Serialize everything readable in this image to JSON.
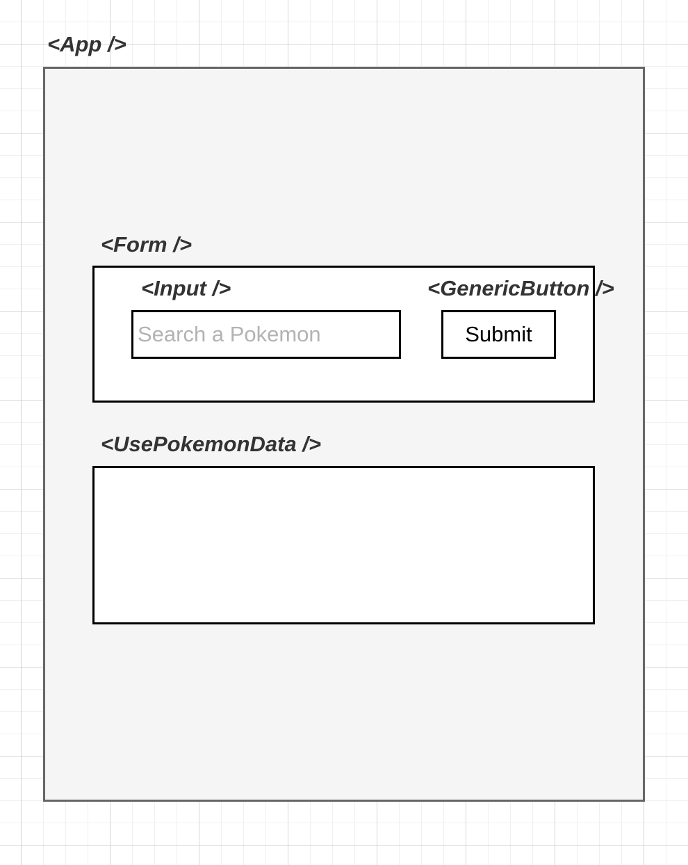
{
  "app": {
    "label": "<App />"
  },
  "form": {
    "label": "<Form />"
  },
  "input": {
    "label": "<Input />",
    "placeholder": "Search a Pokemon"
  },
  "button": {
    "label": "<GenericButton />",
    "text": "Submit"
  },
  "data_component": {
    "label": "<UsePokemonData />"
  },
  "colors": {
    "app_fill": "#f5f5f5",
    "app_stroke": "#666666",
    "box_stroke": "#000000",
    "label_text": "#333333",
    "placeholder_text": "#b3b3b3"
  }
}
